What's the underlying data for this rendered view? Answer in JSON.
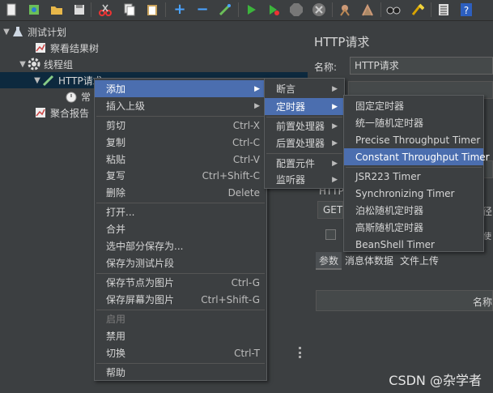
{
  "toolbar": {
    "icons": [
      "new-icon",
      "templates-icon",
      "open-icon",
      "save-icon",
      "cut-icon",
      "copy-icon",
      "paste-icon",
      "expand-icon",
      "collapse-icon",
      "toggle-icon",
      "start-icon",
      "start-no-pause-icon",
      "stop-icon",
      "shutdown-icon",
      "clear-icon",
      "clear-all-icon",
      "search-icon",
      "reset-search-icon",
      "function-helper-icon",
      "help-icon"
    ]
  },
  "tree": {
    "test_plan": "测试计划",
    "view_results_tree": "察看结果树",
    "thread_group": "线程组",
    "http_request": "HTTP请求",
    "constant_timer": "常",
    "aggregate_report": "聚合报告"
  },
  "panel": {
    "title": "HTTP请求",
    "name_label": "名称:",
    "name_value": "HTTP请求",
    "http_label": "HTTP",
    "method": "GET",
    "path_partial": "径",
    "tabs": [
      "参数",
      "消息体数据",
      "文件上传"
    ],
    "column_name": "名称"
  },
  "context_menu": {
    "items": [
      {
        "label": "添加",
        "submenu": true
      },
      {
        "label": "插入上级",
        "submenu": true
      },
      {
        "label": "剪切",
        "shortcut": "Ctrl-X"
      },
      {
        "label": "复制",
        "shortcut": "Ctrl-C"
      },
      {
        "label": "粘贴",
        "shortcut": "Ctrl-V"
      },
      {
        "label": "复写",
        "shortcut": "Ctrl+Shift-C"
      },
      {
        "label": "删除",
        "shortcut": "Delete"
      },
      {
        "label": "打开..."
      },
      {
        "label": "合并"
      },
      {
        "label": "选中部分保存为..."
      },
      {
        "label": "保存为测试片段"
      },
      {
        "label": "保存节点为图片",
        "shortcut": "Ctrl-G"
      },
      {
        "label": "保存屏幕为图片",
        "shortcut": "Ctrl+Shift-G"
      },
      {
        "label": "启用"
      },
      {
        "label": "禁用"
      },
      {
        "label": "切换",
        "shortcut": "Ctrl-T"
      },
      {
        "label": "帮助"
      }
    ]
  },
  "add_submenu": {
    "items": [
      "断言",
      "定时器",
      "前置处理器",
      "后置处理器",
      "配置元件",
      "监听器"
    ]
  },
  "timer_submenu": {
    "items": [
      "固定定时器",
      "统一随机定时器",
      "Precise Throughput Timer",
      "Constant Throughput Timer",
      "JSR223 Timer",
      "Synchronizing Timer",
      "泊松随机定时器",
      "高斯随机定时器",
      "BeanShell Timer"
    ]
  },
  "watermark": "CSDN @杂学者",
  "colors": {
    "background": "#3c3f41",
    "highlight": "#4b6eaf",
    "tree_selection": "#0d293e"
  }
}
